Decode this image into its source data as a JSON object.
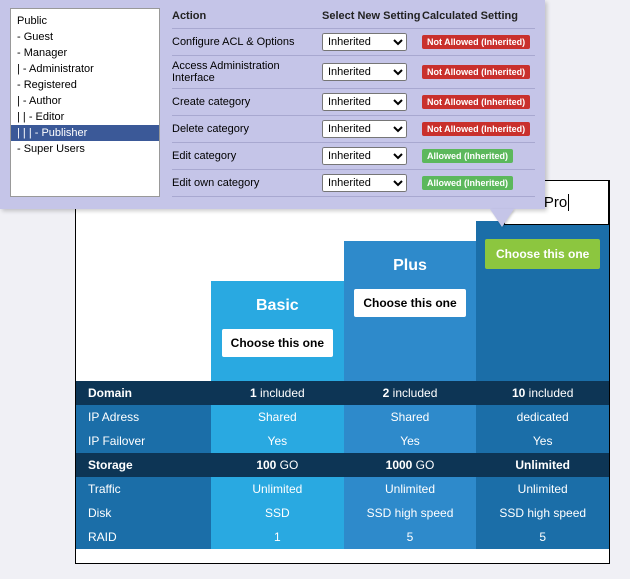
{
  "acl": {
    "headers": {
      "action": "Action",
      "select": "Select New Setting",
      "calc": "Calculated Setting"
    },
    "tree": [
      {
        "label": "Public",
        "depth": 0,
        "selected": false
      },
      {
        "label": "- Guest",
        "depth": 1,
        "selected": false
      },
      {
        "label": "- Manager",
        "depth": 1,
        "selected": false
      },
      {
        "label": "| - Administrator",
        "depth": 2,
        "selected": false
      },
      {
        "label": "- Registered",
        "depth": 1,
        "selected": false
      },
      {
        "label": "| - Author",
        "depth": 2,
        "selected": false
      },
      {
        "label": "| | - Editor",
        "depth": 3,
        "selected": false
      },
      {
        "label": "| | | - Publisher",
        "depth": 4,
        "selected": true
      },
      {
        "label": "- Super Users",
        "depth": 1,
        "selected": false
      }
    ],
    "rows": [
      {
        "action": "Configure ACL & Options",
        "select": "Inherited",
        "calc": "Not Allowed (Inherited)",
        "calcClass": "red"
      },
      {
        "action": "Access Administration Interface",
        "select": "Inherited",
        "calc": "Not Allowed (Inherited)",
        "calcClass": "red"
      },
      {
        "action": "Create category",
        "select": "Inherited",
        "calc": "Not Allowed (Inherited)",
        "calcClass": "red"
      },
      {
        "action": "Delete category",
        "select": "Inherited",
        "calc": "Not Allowed (Inherited)",
        "calcClass": "red"
      },
      {
        "action": "Edit category",
        "select": "Inherited",
        "calc": "Allowed (Inherited)",
        "calcClass": "green"
      },
      {
        "action": "Edit own category",
        "select": "Inherited",
        "calc": "Allowed (Inherited)",
        "calcClass": "green"
      }
    ]
  },
  "pricing": {
    "pro_label": "Pro",
    "choose": "Choose this one",
    "plans": {
      "basic": "Basic",
      "plus": "Plus"
    },
    "rows": {
      "domain_header": "Domain",
      "domain": {
        "basic_num": "1",
        "basic_txt": " included",
        "plus_num": "2",
        "plus_txt": " included",
        "pro_num": "10",
        "pro_txt": " included"
      },
      "ip_address": {
        "label": "IP Adress",
        "basic": "Shared",
        "plus": "Shared",
        "pro": "dedicated"
      },
      "ip_failover": {
        "label": "IP Failover",
        "basic": "Yes",
        "plus": "Yes",
        "pro": "Yes"
      },
      "storage_header": "Storage",
      "storage": {
        "basic_num": "100",
        "basic_txt": " GO",
        "plus_num": "1000",
        "plus_txt": " GO",
        "pro": "Unlimited"
      },
      "traffic": {
        "label": "Traffic",
        "basic": "Unlimited",
        "plus": "Unlimited",
        "pro": "Unlimited"
      },
      "disk": {
        "label": "Disk",
        "basic": "SSD",
        "plus": "SSD high speed",
        "pro": "SSD high speed"
      },
      "raid": {
        "label": "RAID",
        "basic": "1",
        "plus": "5",
        "pro": "5"
      }
    }
  }
}
